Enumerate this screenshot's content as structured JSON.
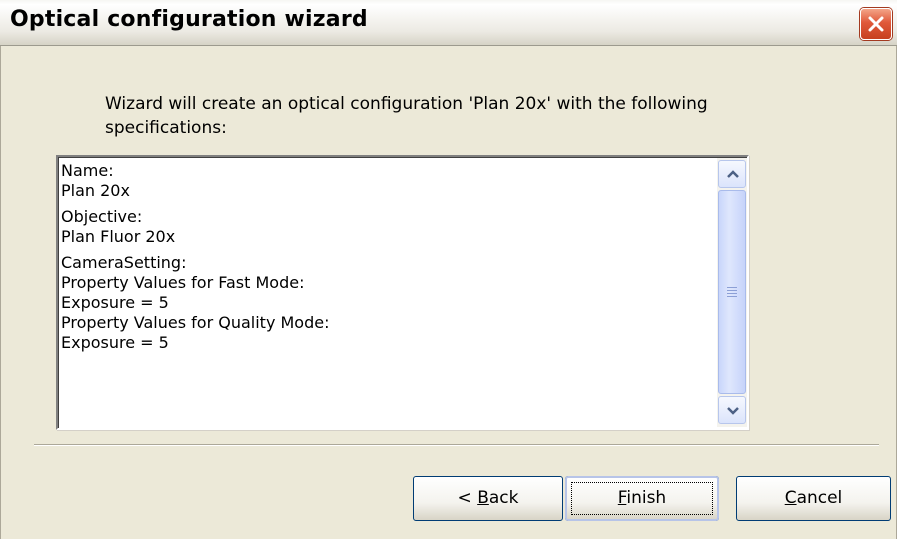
{
  "window": {
    "title": "Optical configuration wizard"
  },
  "intro": {
    "text": "Wizard will create an optical configuration 'Plan 20x' with the following specifications:"
  },
  "specifications": [
    {
      "lines": [
        "Name:",
        "Plan 20x"
      ]
    },
    {
      "lines": [
        "Objective:",
        "Plan Fluor 20x"
      ]
    },
    {
      "lines": [
        "CameraSetting:",
        "Property Values for Fast Mode:",
        "Exposure = 5",
        "Property Values for Quality Mode:",
        "Exposure = 5"
      ]
    }
  ],
  "buttons": {
    "back": {
      "prefix": "< ",
      "mnemonic": "B",
      "rest": "ack"
    },
    "finish": {
      "prefix": "",
      "mnemonic": "F",
      "rest": "inish"
    },
    "cancel": {
      "prefix": "",
      "mnemonic": "C",
      "rest": "ancel"
    }
  },
  "icons": {
    "close": "close-icon",
    "scroll_up": "chevron-up-icon",
    "scroll_down": "chevron-down-icon"
  },
  "colors": {
    "close_button": "#e0593a",
    "button_border": "#003c74",
    "scrollbar": "#c9d6fb"
  }
}
